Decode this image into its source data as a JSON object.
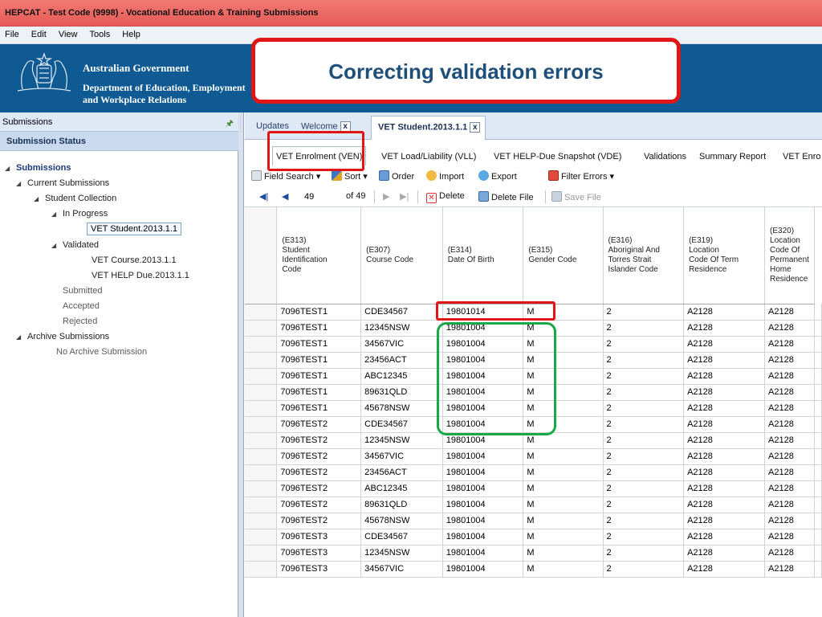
{
  "window": {
    "title": "HEPCAT - Test Code (9998) - Vocational Education & Training Submissions"
  },
  "menu": [
    "File",
    "Edit",
    "View",
    "Tools",
    "Help"
  ],
  "banner": {
    "gov": "Australian Government",
    "dept_line1": "Department of Education, Employment",
    "dept_line2": "and Workplace Relations"
  },
  "callout": {
    "text": "Correcting validation errors"
  },
  "sidebar": {
    "header": "Submissions",
    "status_title": "Submission Status",
    "tree": {
      "submissions": "Submissions",
      "current": "Current Submissions",
      "student_collection": "Student Collection",
      "in_progress": "In Progress",
      "vet_student": "VET Student.2013.1.1",
      "validated": "Validated",
      "vet_course": "VET Course.2013.1.1",
      "vet_help": "VET HELP Due.2013.1.1",
      "submitted": "Submitted",
      "accepted": "Accepted",
      "rejected": "Rejected",
      "archive": "Archive Submissions",
      "no_archive": "No Archive Submission"
    }
  },
  "doc_tabs": {
    "updates": "Updates",
    "welcome": "Welcome",
    "vet_student": "VET Student.2013.1.1"
  },
  "sub_tabs": [
    "VET Enrolment (VEN)",
    "VET Load/Liability (VLL)",
    "VET HELP-Due Snapshot (VDE)",
    "Validations",
    "Summary Report",
    "VET Enro"
  ],
  "toolbar": {
    "field_search": "Field Search",
    "sort": "Sort",
    "order": "Order",
    "import": "Import",
    "export": "Export",
    "filter_errors": "Filter Errors",
    "page_value": "49",
    "page_of": "of 49",
    "delete": "Delete",
    "delete_file": "Delete File",
    "save_file": "Save File"
  },
  "table": {
    "headers": [
      "(E313)\nStudent\nIdentification\nCode",
      "(E307)\nCourse Code",
      "(E314)\nDate Of Birth",
      "(E315)\nGender Code",
      "(E316)\nAboriginal And\nTorres Strait\nIslander Code",
      "(E319)\nLocation\nCode Of Term\nResidence",
      "(E320)\nLocation\nCode Of\nPermanent\nHome\nResidence"
    ],
    "rows": [
      [
        "7096TEST1",
        "CDE34567",
        "19801014",
        "M",
        "2",
        "A2128",
        "A2128"
      ],
      [
        "7096TEST1",
        "12345NSW",
        "19801004",
        "M",
        "2",
        "A2128",
        "A2128"
      ],
      [
        "7096TEST1",
        "34567VIC",
        "19801004",
        "M",
        "2",
        "A2128",
        "A2128"
      ],
      [
        "7096TEST1",
        "23456ACT",
        "19801004",
        "M",
        "2",
        "A2128",
        "A2128"
      ],
      [
        "7096TEST1",
        "ABC12345",
        "19801004",
        "M",
        "2",
        "A2128",
        "A2128"
      ],
      [
        "7096TEST1",
        "89631QLD",
        "19801004",
        "M",
        "2",
        "A2128",
        "A2128"
      ],
      [
        "7096TEST1",
        "45678NSW",
        "19801004",
        "M",
        "2",
        "A2128",
        "A2128"
      ],
      [
        "7096TEST2",
        "CDE34567",
        "19801004",
        "M",
        "2",
        "A2128",
        "A2128"
      ],
      [
        "7096TEST2",
        "12345NSW",
        "19801004",
        "M",
        "2",
        "A2128",
        "A2128"
      ],
      [
        "7096TEST2",
        "34567VIC",
        "19801004",
        "M",
        "2",
        "A2128",
        "A2128"
      ],
      [
        "7096TEST2",
        "23456ACT",
        "19801004",
        "M",
        "2",
        "A2128",
        "A2128"
      ],
      [
        "7096TEST2",
        "ABC12345",
        "19801004",
        "M",
        "2",
        "A2128",
        "A2128"
      ],
      [
        "7096TEST2",
        "89631QLD",
        "19801004",
        "M",
        "2",
        "A2128",
        "A2128"
      ],
      [
        "7096TEST2",
        "45678NSW",
        "19801004",
        "M",
        "2",
        "A2128",
        "A2128"
      ],
      [
        "7096TEST3",
        "CDE34567",
        "19801004",
        "M",
        "2",
        "A2128",
        "A2128"
      ],
      [
        "7096TEST3",
        "12345NSW",
        "19801004",
        "M",
        "2",
        "A2128",
        "A2128"
      ],
      [
        "7096TEST3",
        "34567VIC",
        "19801004",
        "M",
        "2",
        "A2128",
        "A2128"
      ]
    ]
  },
  "colors": {
    "title_bar": "#e65a55",
    "banner": "#0f5a92",
    "callout_border": "#e01515",
    "callout_text": "#1e4f7a",
    "highlight_red": "#e01515",
    "highlight_green": "#17a847"
  }
}
